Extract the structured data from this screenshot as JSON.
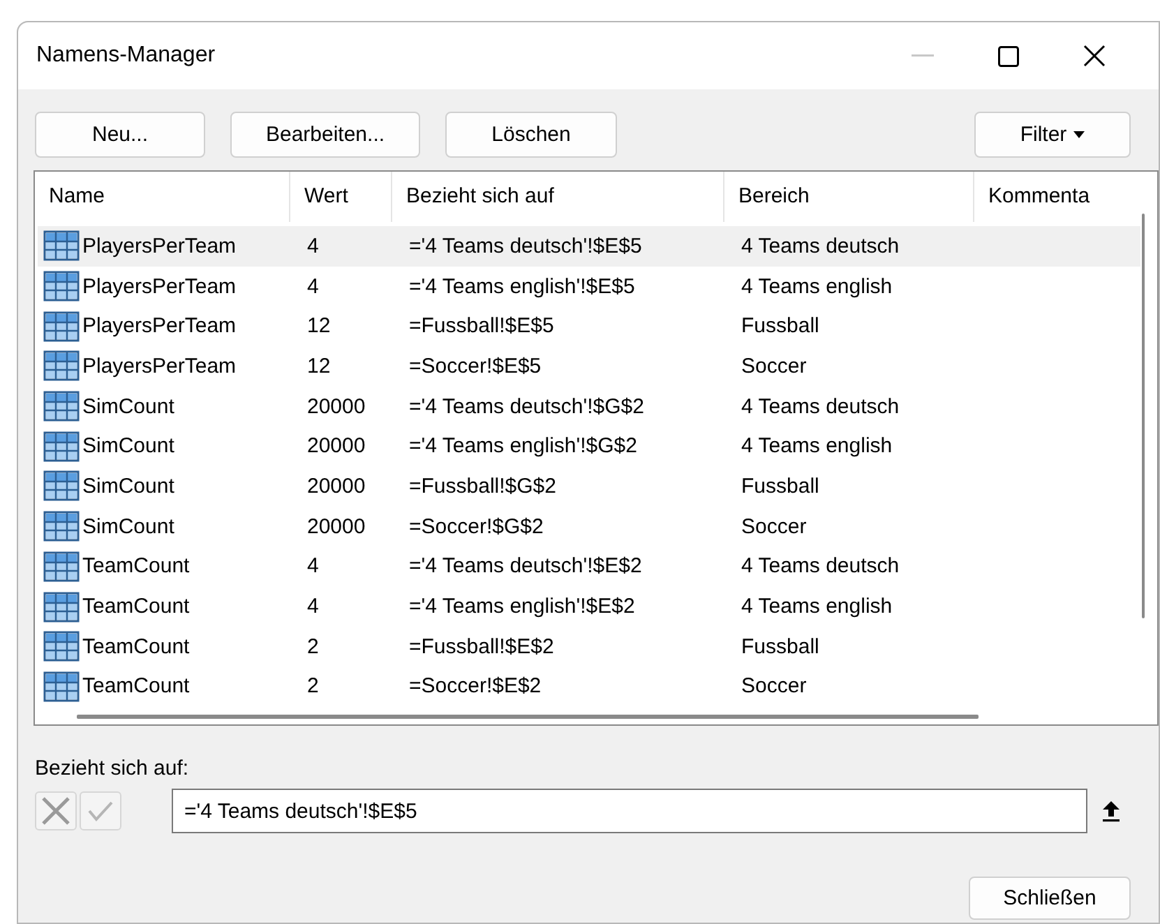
{
  "window": {
    "title": "Namens-Manager"
  },
  "toolbar": {
    "buttons": [
      "Neu...",
      "Bearbeiten...",
      "Löschen"
    ],
    "filter_button": "Filter"
  },
  "table": {
    "columns": [
      "Name",
      "Wert",
      "Bezieht sich auf",
      "Bereich",
      "Kommenta"
    ],
    "rows": [
      {
        "name": "PlayersPerTeam",
        "value": "4",
        "refers_to": "='4 Teams deutsch'!$E$5",
        "scope": "4 Teams deutsch",
        "selected": true
      },
      {
        "name": "PlayersPerTeam",
        "value": "4",
        "refers_to": "='4 Teams english'!$E$5",
        "scope": "4 Teams english",
        "selected": false
      },
      {
        "name": "PlayersPerTeam",
        "value": "12",
        "refers_to": "=Fussball!$E$5",
        "scope": "Fussball",
        "selected": false
      },
      {
        "name": "PlayersPerTeam",
        "value": "12",
        "refers_to": "=Soccer!$E$5",
        "scope": "Soccer",
        "selected": false
      },
      {
        "name": "SimCount",
        "value": "20000",
        "refers_to": "='4 Teams deutsch'!$G$2",
        "scope": "4 Teams deutsch",
        "selected": false
      },
      {
        "name": "SimCount",
        "value": "20000",
        "refers_to": "='4 Teams english'!$G$2",
        "scope": "4 Teams english",
        "selected": false
      },
      {
        "name": "SimCount",
        "value": "20000",
        "refers_to": "=Fussball!$G$2",
        "scope": "Fussball",
        "selected": false
      },
      {
        "name": "SimCount",
        "value": "20000",
        "refers_to": "=Soccer!$G$2",
        "scope": "Soccer",
        "selected": false
      },
      {
        "name": "TeamCount",
        "value": "4",
        "refers_to": "='4 Teams deutsch'!$E$2",
        "scope": "4 Teams deutsch",
        "selected": false
      },
      {
        "name": "TeamCount",
        "value": "4",
        "refers_to": "='4 Teams english'!$E$2",
        "scope": "4 Teams english",
        "selected": false
      },
      {
        "name": "TeamCount",
        "value": "2",
        "refers_to": "=Fussball!$E$2",
        "scope": "Fussball",
        "selected": false
      },
      {
        "name": "TeamCount",
        "value": "2",
        "refers_to": "=Soccer!$E$2",
        "scope": "Soccer",
        "selected": false
      }
    ]
  },
  "refers_to_field": {
    "label": "Bezieht sich auf:",
    "value": "='4 Teams deutsch'!$E$5"
  },
  "close_button": "Schließen"
}
